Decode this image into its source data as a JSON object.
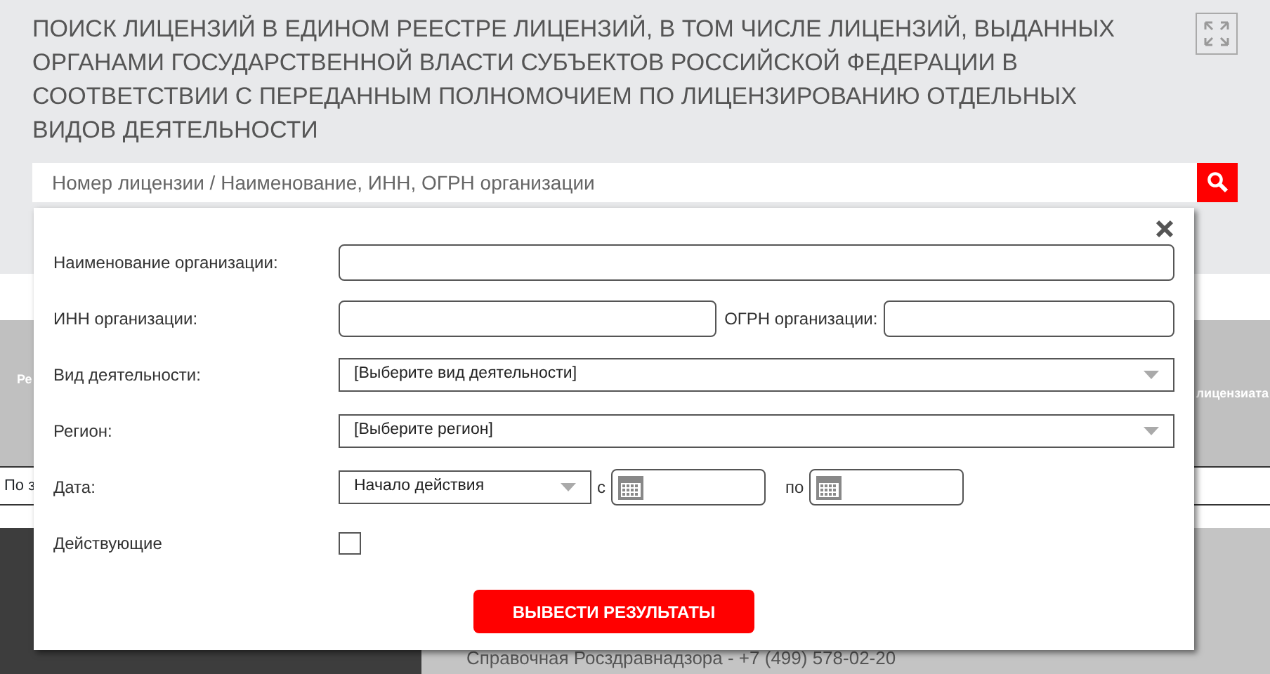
{
  "page_title": "ПОИСК ЛИЦЕНЗИЙ В ЕДИНОМ РЕЕСТРЕ ЛИЦЕНЗИЙ, В ТОМ ЧИСЛЕ ЛИЦЕНЗИЙ, ВЫДАННЫХ ОРГАНАМИ ГОСУДАРСТВЕННОЙ ВЛАСТИ СУБЪЕКТОВ РОССИЙСКОЙ ФЕДЕРАЦИИ В СООТВЕТСТВИИ С ПЕРЕДАННЫМ ПОЛНОМОЧИЕМ ПО ЛИЦЕНЗИРОВАНИЮ ОТДЕЛЬНЫХ ВИДОВ ДЕЯТЕЛЬНОСТИ",
  "search": {
    "placeholder": "Номер лицензии / Наименование, ИНН, ОГРН организации"
  },
  "background": {
    "table_header_left": "Ре",
    "table_header_right": "лицензиата",
    "filter_row": "По з",
    "footer_phone": "Справочная Росздравнадзора - +7 (499) 578-02-20"
  },
  "dialog": {
    "rows": [
      {
        "kind": "text",
        "label": "Наименование организации:"
      },
      {
        "kind": "pair",
        "label": "ИНН организации:",
        "second_label": "ОГРН организации:"
      },
      {
        "kind": "select",
        "label": "Вид деятельности:",
        "value": "[Выберите вид деятельности]"
      },
      {
        "kind": "select",
        "label": "Регион:",
        "value": "[Выберите регион]"
      },
      {
        "kind": "date",
        "label": "Дата:",
        "value": "Начало действия",
        "from_label": "с",
        "to_label": "по"
      },
      {
        "kind": "checkbox",
        "label": "Действующие",
        "checked": false
      }
    ],
    "submit": "ВЫВЕСТИ РЕЗУЛЬТАТЫ"
  }
}
